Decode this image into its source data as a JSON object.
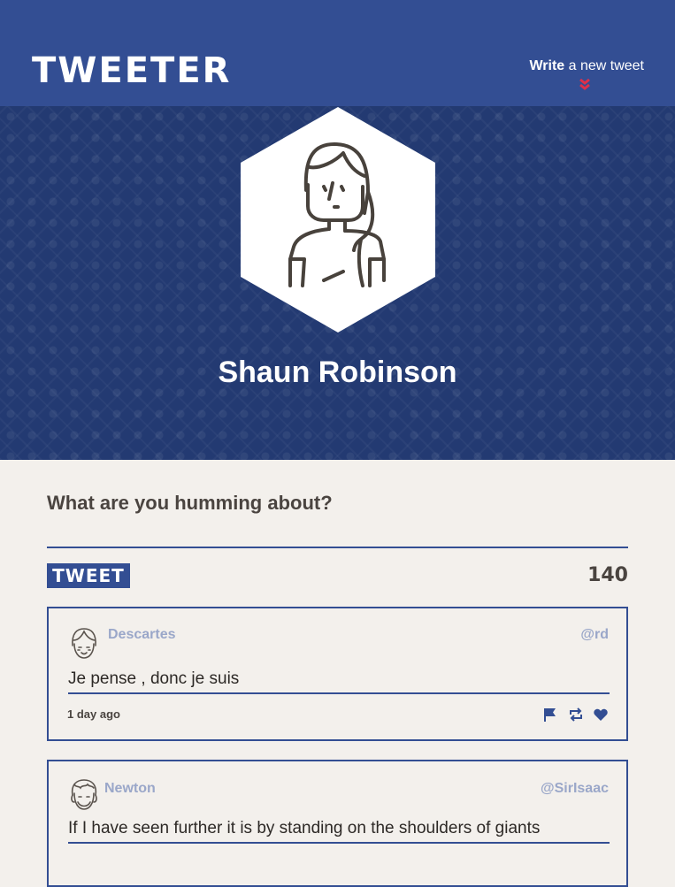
{
  "header": {
    "logo": "TWEETER",
    "compose_bold": "Write",
    "compose_rest": " a new tweet"
  },
  "profile": {
    "name": "Shaun Robinson"
  },
  "composer": {
    "prompt": "What are you humming about?",
    "tweet_button": "TWEET",
    "counter": "140"
  },
  "tweets": [
    {
      "name": "Descartes",
      "handle": "@rd",
      "text": "Je pense , donc je suis",
      "time": "1 day ago"
    },
    {
      "name": "Newton",
      "handle": "@SirIsaac",
      "text": "If I have seen further it is by standing on the shoulders of giants"
    }
  ],
  "colors": {
    "brand_blue": "#334e93",
    "hero_blue": "#233a72",
    "accent_red": "#e0304a",
    "background": "#f3f0ec",
    "muted_text": "#9aa7c9"
  },
  "icons": [
    "chevron-double-down-icon",
    "flag-icon",
    "retweet-icon",
    "heart-icon"
  ]
}
